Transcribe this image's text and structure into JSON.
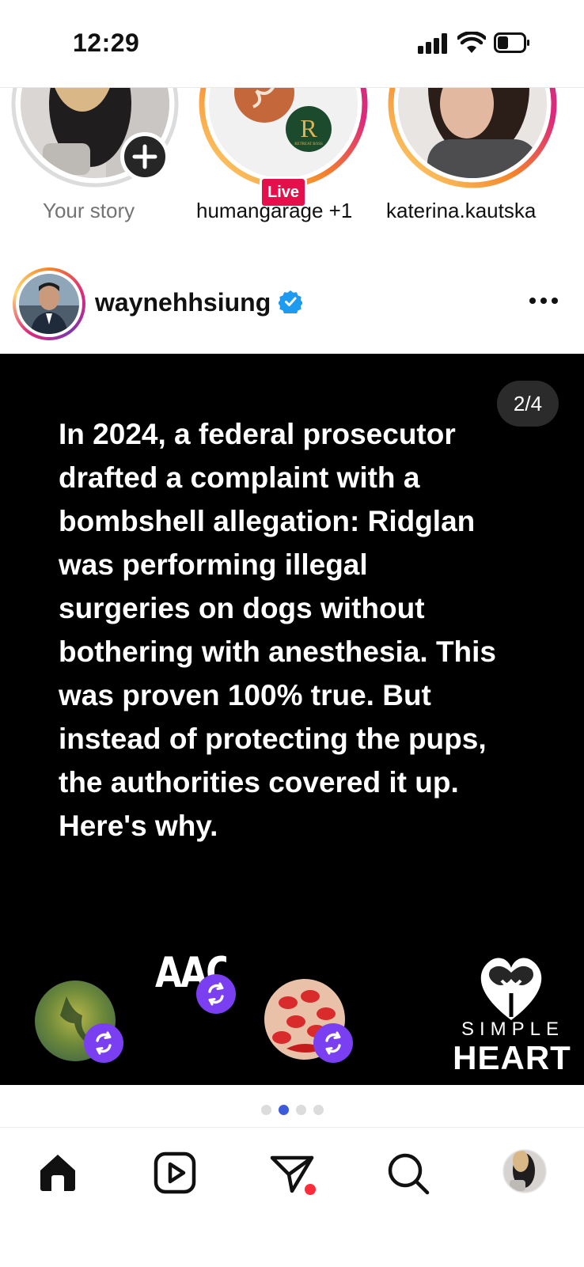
{
  "status_bar": {
    "time": "12:29"
  },
  "stories": [
    {
      "label": "Your story",
      "badge": ""
    },
    {
      "label": "humangarage +1",
      "badge": "Live"
    },
    {
      "label": "katerina.kautska",
      "badge": ""
    }
  ],
  "post": {
    "username": "waynehhsiung",
    "verified": true,
    "counter": "2/4",
    "text": "In 2024, a federal prosecutor drafted a complaint with a bombshell allegation: Ridglan was performing illegal surgeries on dogs without bothering with anesthesia. This was proven 100% true. But instead of protecting the pups, the authorities covered it up. Here's why.",
    "logo_line1": "SIMPLE",
    "logo_line2": "HEART",
    "aac_text": "AAC",
    "r_logo_letter": "R",
    "r_logo_subtext": "RETREAT BOSS",
    "carousel": {
      "total": 4,
      "active_index": 1
    }
  },
  "colors": {
    "live_badge": "#e5104b",
    "verified_blue": "#1d9bf0",
    "active_dot": "#3b5bdb",
    "repost_purple": "#7b3ff2",
    "notification_dot": "#ff2d3a"
  },
  "nav_icons": [
    "home-icon",
    "reels-icon",
    "direct-messages-icon",
    "search-icon",
    "profile-avatar"
  ]
}
